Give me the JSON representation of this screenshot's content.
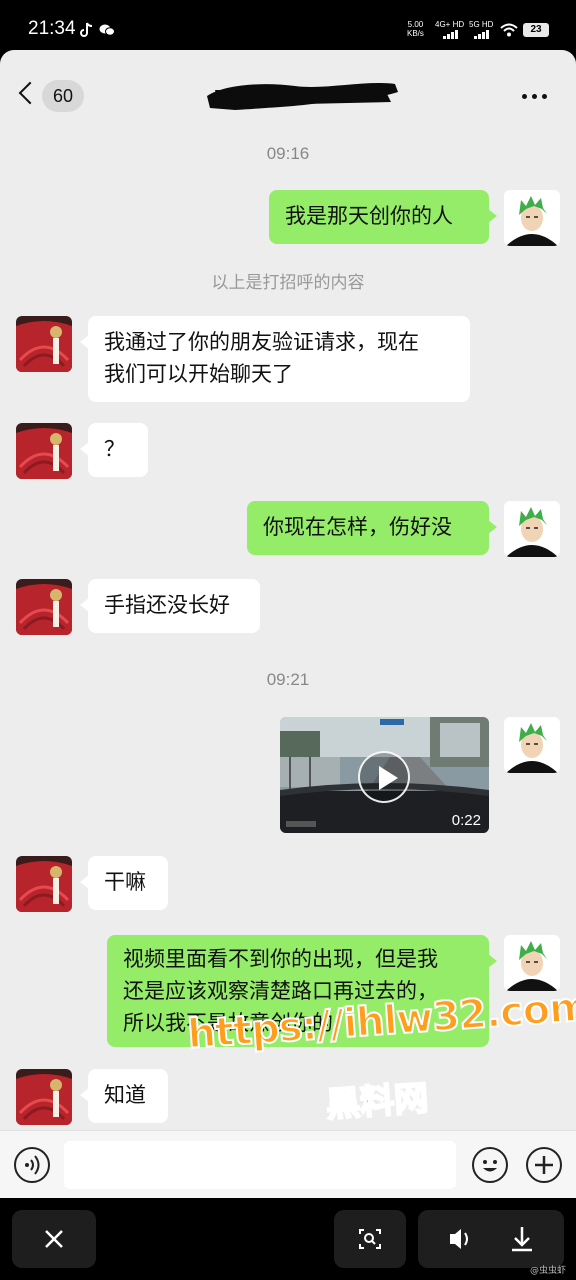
{
  "status_bar": {
    "time": "21:34",
    "app_icons": [
      "tiktok-icon",
      "wechat-icon"
    ],
    "speed_value": "5.00",
    "speed_unit": "KB/s",
    "net1": "4G+ HD",
    "net2": "5G HD",
    "battery": "23"
  },
  "header": {
    "unread_count": "60",
    "title_redacted": true
  },
  "messages": [
    {
      "type": "time",
      "text": "09:16"
    },
    {
      "type": "msg",
      "side": "me",
      "text": "我是那天创你的人"
    },
    {
      "type": "system",
      "text": "以上是打招呼的内容"
    },
    {
      "type": "msg",
      "side": "them",
      "lines": [
        "我通过了你的朋友验证请求，现在",
        "我们可以开始聊天了"
      ]
    },
    {
      "type": "msg",
      "side": "them",
      "text": "？"
    },
    {
      "type": "msg",
      "side": "me",
      "text": "你现在怎样，伤好没"
    },
    {
      "type": "msg",
      "side": "them",
      "text": "手指还没长好"
    },
    {
      "type": "time",
      "text": "09:21"
    },
    {
      "type": "video",
      "side": "me",
      "duration": "0:22"
    },
    {
      "type": "msg",
      "side": "them",
      "text": "干嘛"
    },
    {
      "type": "msg",
      "side": "me",
      "lines": [
        "视频里面看不到你的出现，但是我",
        "还是应该观察清楚路口再过去的，",
        "所以我不是故意创你的"
      ]
    },
    {
      "type": "msg",
      "side": "them",
      "text": "知道"
    }
  ],
  "watermark": {
    "url": "https://ihlw32.com",
    "name": "黑料网"
  },
  "input_bar": {
    "icons": [
      "voice-icon",
      "emoji-icon",
      "plus-icon"
    ]
  },
  "bottom_controls": {
    "icons": [
      "close-icon",
      "scan-icon",
      "volume-icon",
      "download-icon"
    ]
  },
  "credit": "@虫虫虾",
  "colors": {
    "chat_bg": "#ededed",
    "my_bubble": "#95ec69",
    "their_bubble": "#ffffff",
    "watermark": "#ff9d1c"
  }
}
